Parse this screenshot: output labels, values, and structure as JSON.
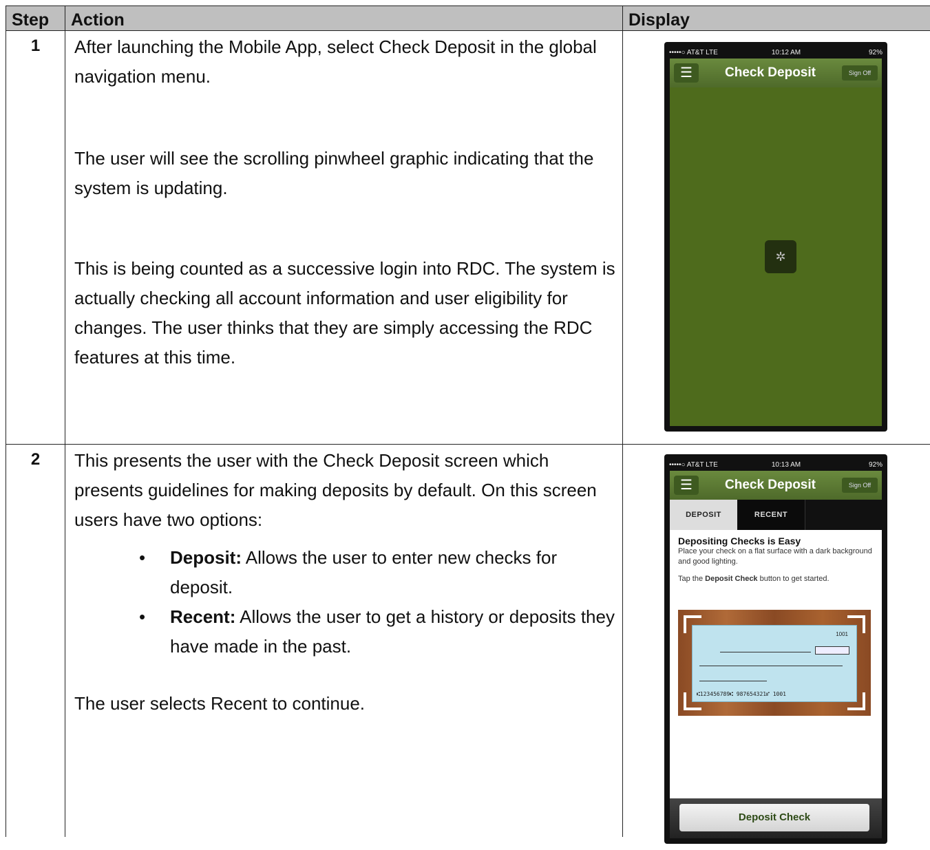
{
  "table": {
    "headers": {
      "step": "Step",
      "action": "Action",
      "display": "Display"
    },
    "rows": [
      {
        "step": "1",
        "paragraphs": [
          "After launching the Mobile App, select Check Deposit in the global navigation menu.",
          "The user will see the scrolling pinwheel graphic indicating that the system is updating.",
          "This is being counted as a successive login into RDC.  The system is actually checking all account information and user eligibility for changes.  The user thinks that they are simply accessing the RDC features at this time."
        ]
      },
      {
        "step": "2",
        "intro": "This presents the user with the Check Deposit screen which presents guidelines for making deposits by default.  On this screen users have two options:",
        "bullets": [
          {
            "term": "Deposit:",
            "text": " Allows the user to enter new checks for deposit."
          },
          {
            "term": "Recent:",
            "text": " Allows the user to get a history or deposits they have made in the past."
          }
        ],
        "outro": "The user selects Recent to continue."
      }
    ]
  },
  "phone1": {
    "carrier": "•••••○ AT&T  LTE",
    "time": "10:12 AM",
    "battery": "92%",
    "title": "Check Deposit",
    "signoff": "Sign Off",
    "menu_icon": "☰",
    "spinner_icon": "✲"
  },
  "phone2": {
    "carrier": "•••••○ AT&T  LTE",
    "time": "10:13 AM",
    "battery": "92%",
    "title": "Check Deposit",
    "signoff": "Sign Off",
    "menu_icon": "☰",
    "tab_deposit": "DEPOSIT",
    "tab_recent": "RECENT",
    "content_title": "Depositing Checks is Easy",
    "content_text1": "Place your check on a flat surface with a dark background and good lighting.",
    "content_text2_pre": "Tap the ",
    "content_text2_bold": "Deposit Check",
    "content_text2_post": " button to get started.",
    "check_number": "1001",
    "micr": "⑆123456789⑆ 987654321⑈ 1001",
    "button": "Deposit Check"
  }
}
